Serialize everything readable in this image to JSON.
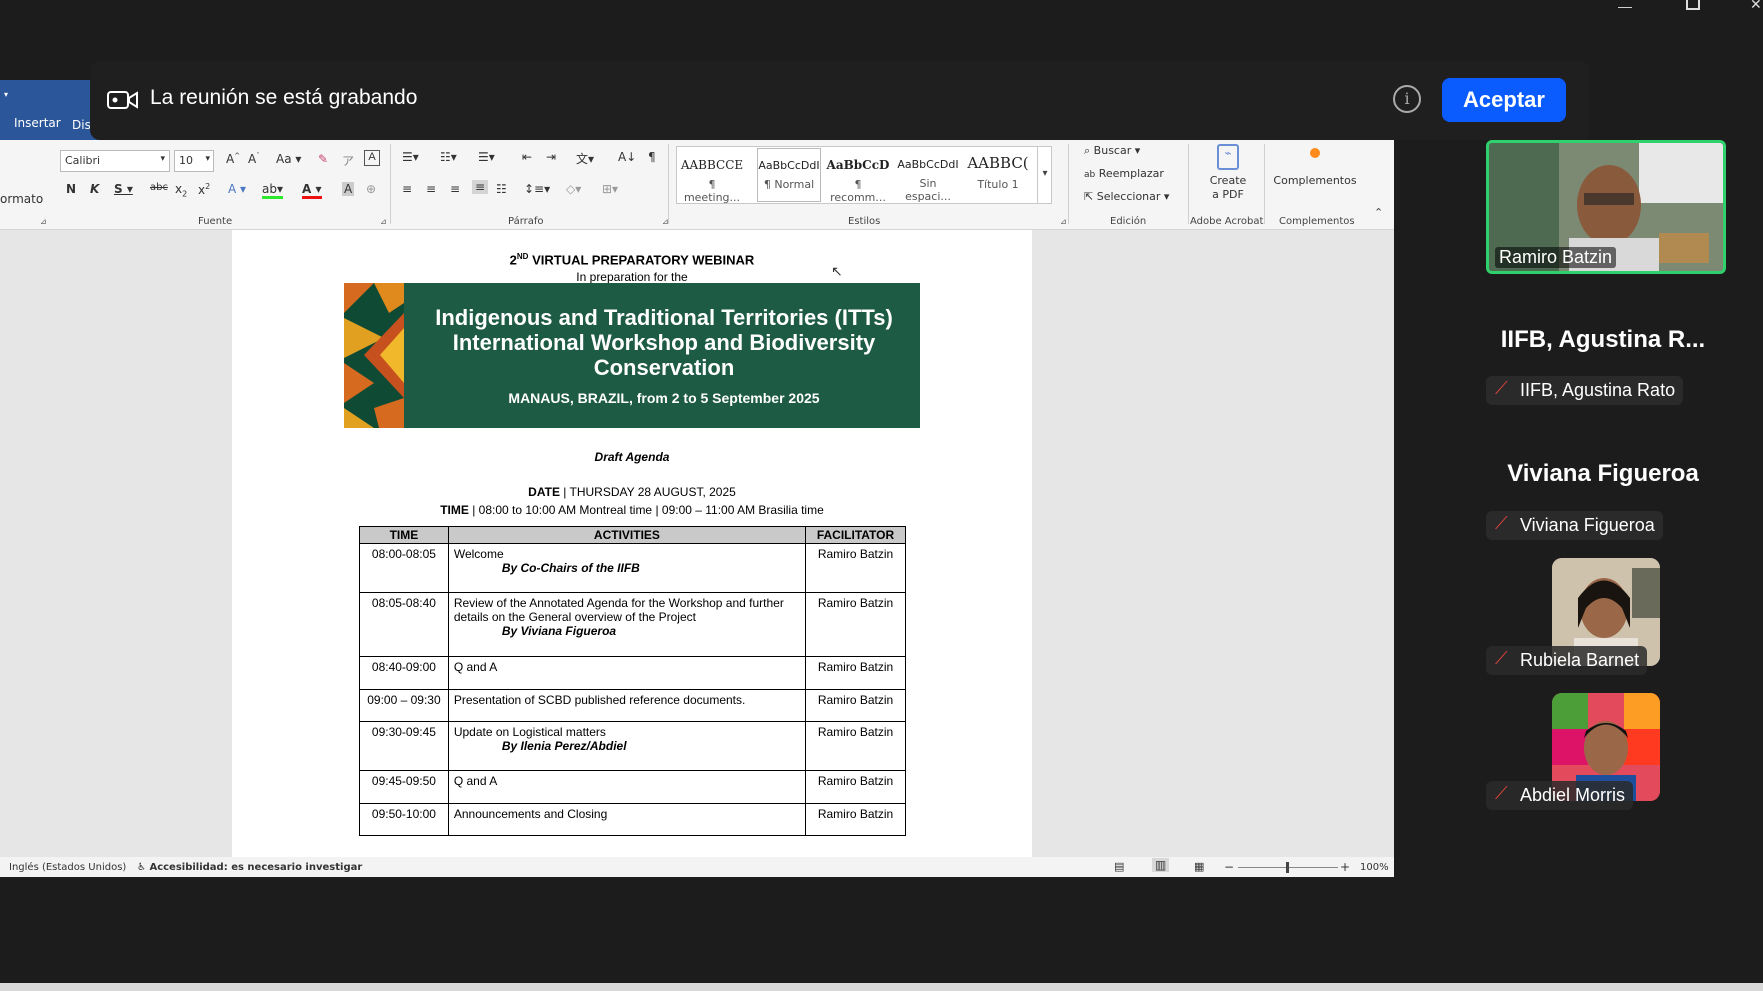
{
  "word": {
    "tabs": [
      "Insertar",
      "Dis"
    ],
    "format_label": "ormato",
    "font": {
      "name": "Calibri",
      "size": "10"
    },
    "groups": {
      "fuente": "Fuente",
      "parrafo": "Párrafo",
      "estilos": "Estilos",
      "edicion": "Edición",
      "acrobat": "Adobe Acrobat",
      "complementos": "Complementos"
    },
    "styles": [
      {
        "preview": "AABBCCE",
        "name": "¶ meeting..."
      },
      {
        "preview": "AaBbCcDdI",
        "name": "¶ Normal"
      },
      {
        "preview": "AaBbCcD",
        "name": "¶ recomm..."
      },
      {
        "preview": "AaBbCcDdI",
        "name": "Sin espaci..."
      },
      {
        "preview": "AABBC(",
        "name": "Título 1"
      }
    ],
    "edit": {
      "buscar": "Buscar",
      "reemplazar": "Reemplazar",
      "seleccionar": "Seleccionar"
    },
    "acrobat_btn": "Create a PDF",
    "complementos_btn": "Complementos",
    "status": {
      "language": "Inglés (Estados Unidos)",
      "accessibility": "Accesibilidad: es necesario investigar",
      "zoom": "100%"
    }
  },
  "document": {
    "heading": "VIRTUAL PREPARATORY WEBINAR",
    "heading_num": "2",
    "heading_sup": "ND",
    "subheading": "In preparation for the",
    "banner": {
      "title1": "Indigenous and Traditional Territories (ITTs)",
      "title2": "International Workshop and Biodiversity",
      "title3": "Conservation",
      "location": "MANAUS, BRAZIL, from 2 to 5 September 2025"
    },
    "draft": "Draft Agenda",
    "date_label": "DATE",
    "date_value": " | THURSDAY 28 AUGUST, 2025",
    "time_label": "TIME",
    "time_value": " | 08:00 to 10:00 AM Montreal time | 09:00 – 11:00 AM Brasilia time",
    "table": {
      "headers": [
        "TIME",
        "ACTIVITIES",
        "FACILITATOR"
      ],
      "rows": [
        {
          "time": "08:00-08:05",
          "activity": "Welcome",
          "by": "By Co-Chairs of the IIFB",
          "facilitator": "Ramiro Batzin"
        },
        {
          "time": "08:05-08:40",
          "activity": "Review of the Annotated Agenda for the Workshop and further details on the General overview of the Project",
          "by": "By Viviana Figueroa",
          "facilitator": "Ramiro Batzin"
        },
        {
          "time": "08:40-09:00",
          "activity": "Q and A",
          "by": "",
          "facilitator": "Ramiro Batzin"
        },
        {
          "time": "09:00 – 09:30",
          "activity": "Presentation of SCBD published reference documents.",
          "by": "",
          "facilitator": "Ramiro Batzin"
        },
        {
          "time": "09:30-09:45",
          "activity": "Update on Logistical matters",
          "by": "By Ilenia Perez/Abdiel",
          "facilitator": "Ramiro Batzin"
        },
        {
          "time": "09:45-09:50",
          "activity": "Q and A",
          "by": "",
          "facilitator": "Ramiro Batzin"
        },
        {
          "time": "09:50-10:00",
          "activity": "Announcements and Closing",
          "by": "",
          "facilitator": "Ramiro Batzin"
        }
      ]
    }
  },
  "recording": {
    "message": "La reunión se está grabando",
    "accept": "Aceptar"
  },
  "participants": [
    {
      "name": "Ramiro Batzin",
      "video": true,
      "active": true
    },
    {
      "name": "IIFB, Agustina R...",
      "label": "IIFB, Agustina Rato",
      "muted": true
    },
    {
      "name": "Viviana Figueroa",
      "label": "Viviana Figueroa",
      "muted": true
    },
    {
      "name": "Rubiela Barnet",
      "muted": true
    },
    {
      "name": "Abdiel Morris",
      "muted": true
    }
  ],
  "colors": {
    "word_blue": "#2b579a",
    "zoom_blue": "#0b5cff",
    "banner_green": "#1d5b45",
    "active_speaker": "#2ed16c"
  }
}
